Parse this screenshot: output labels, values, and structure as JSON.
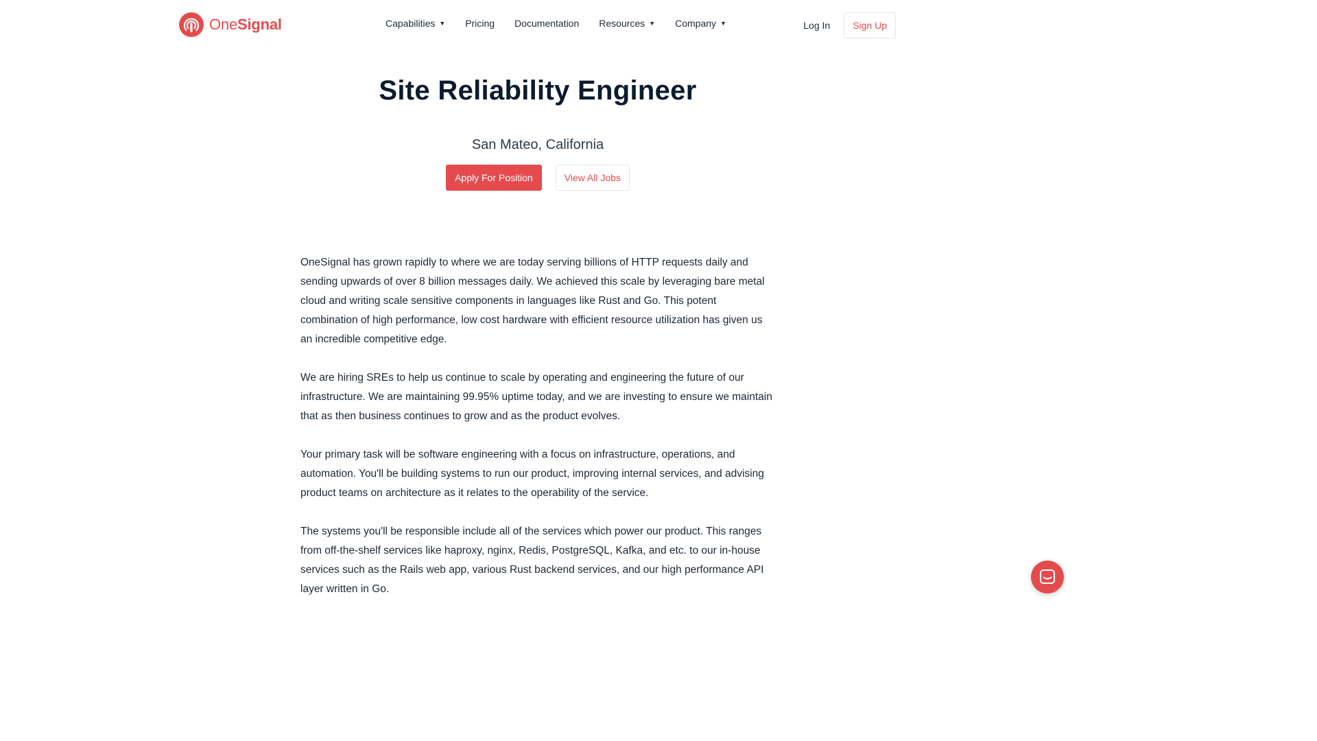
{
  "brand": {
    "name_part1": "One",
    "name_part2": "Signal",
    "accent": "#e54b4d"
  },
  "nav": {
    "items": [
      {
        "label": "Capabilities",
        "dropdown": true
      },
      {
        "label": "Pricing",
        "dropdown": false
      },
      {
        "label": "Documentation",
        "dropdown": false
      },
      {
        "label": "Resources",
        "dropdown": true
      },
      {
        "label": "Company",
        "dropdown": true
      }
    ],
    "login": "Log In",
    "signup": "Sign Up"
  },
  "hero": {
    "title": "Site Reliability Engineer",
    "location": "San Mateo, California",
    "apply_label": "Apply For Position",
    "view_jobs_label": "View All Jobs"
  },
  "body": {
    "paragraphs": [
      "OneSignal has grown rapidly to where we are today serving billions of HTTP requests daily and sending upwards of over 8 billion messages daily. We achieved this scale by leveraging bare metal cloud and writing scale sensitive components in languages like Rust and Go. This potent combination of high performance, low cost hardware with efficient resource utilization has given us an incredible competitive edge.",
      "We are hiring SREs to help us continue to scale by operating and engineering the future of our infrastructure. We are maintaining 99.95% uptime today, and we are investing to ensure we maintain that as then business continues to grow and as the product evolves.",
      "Your primary task will be software engineering with a focus on infrastructure, operations, and automation. You'll be building systems to run our product, improving internal services, and advising product teams on architecture as it relates to the operability of the service.",
      "The systems you'll be responsible include all of the services which power our product. This ranges from off-the-shelf services like haproxy, nginx, Redis, PostgreSQL, Kafka, and etc. to our in-house services such as the Rails web app, various Rust backend services, and our high performance API layer written in Go."
    ]
  },
  "chat_widget": {
    "icon": "chat-icon"
  }
}
